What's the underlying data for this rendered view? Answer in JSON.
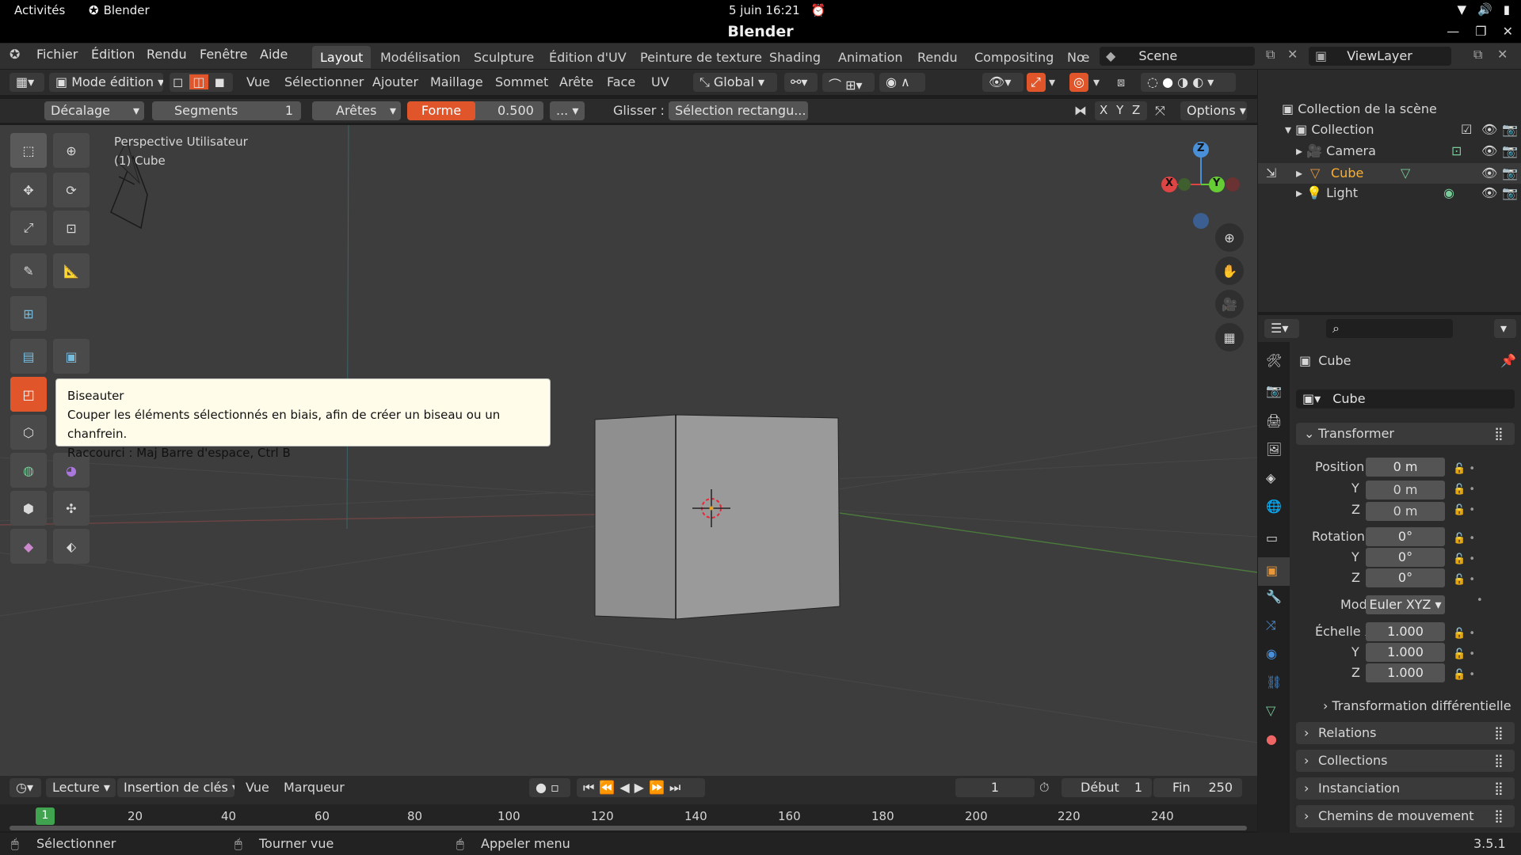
{
  "gnome": {
    "activities": "Activités",
    "app": "Blender",
    "clock": "5 juin  16:21"
  },
  "window": {
    "title": "Blender"
  },
  "menu": {
    "items": [
      "Fichier",
      "Édition",
      "Rendu",
      "Fenêtre",
      "Aide"
    ]
  },
  "workspaces": [
    "Layout",
    "Modélisation",
    "Sculpture",
    "Édition d'UV",
    "Peinture de texture",
    "Shading",
    "Animation",
    "Rendu",
    "Compositing",
    "Nœ"
  ],
  "scene": {
    "scene_name": "Scene",
    "view_layer": "ViewLayer"
  },
  "header": {
    "mode": "Mode édition",
    "menus": [
      "Vue",
      "Sélectionner",
      "Ajouter",
      "Maillage",
      "Sommet",
      "Arête",
      "Face",
      "UV"
    ],
    "orientation": "Global"
  },
  "tool_settings": {
    "offset": "Décalage",
    "segments_label": "Segments",
    "segments_value": "1",
    "affect": "Arêtes",
    "shape_label": "Forme",
    "shape_value": "0.500",
    "more": "...",
    "drag_label": "Glisser :",
    "drag_value": "Sélection rectangu...",
    "axes": [
      "X",
      "Y",
      "Z"
    ],
    "options": "Options"
  },
  "viewport": {
    "perspective": "Perspective Utilisateur",
    "object": "(1) Cube"
  },
  "gizmo": {
    "z": "Z",
    "y": "Y",
    "x": "X"
  },
  "tooltip": {
    "title": "Biseauter",
    "description": "Couper les éléments sélectionnés en biais, afin de créer un biseau ou un chanfrein.",
    "shortcut": "Raccourci : Maj Barre d'espace, Ctrl B"
  },
  "outliner": {
    "root": "Collection de la scène",
    "collection": "Collection",
    "items": [
      "Camera",
      "Cube",
      "Light"
    ]
  },
  "properties": {
    "object_name": "Cube",
    "data_name": "Cube",
    "transform": "Transformer",
    "position_label": "Position X",
    "position": [
      "0 m",
      "0 m",
      "0 m"
    ],
    "rotation_label": "Rotation X",
    "rotation": [
      "0°",
      "0°",
      "0°"
    ],
    "mode_label": "Mode",
    "mode_value": "Euler XYZ",
    "scale_label": "Échelle X",
    "scale": [
      "1.000",
      "1.000",
      "1.000"
    ],
    "y": "Y",
    "z": "Z",
    "delta": "Transformation différentielle",
    "sections": [
      "Relations",
      "Collections",
      "Instanciation",
      "Chemins de mouvement"
    ]
  },
  "timeline": {
    "playback": "Lecture",
    "keying": "Insertion de clés",
    "view": "Vue",
    "marker": "Marqueur",
    "current_frame": "1",
    "start_label": "Début",
    "start": "1",
    "end_label": "Fin",
    "end": "250",
    "ruler_current": "1",
    "ticks": [
      "20",
      "40",
      "60",
      "80",
      "100",
      "120",
      "140",
      "160",
      "180",
      "200",
      "220",
      "240"
    ]
  },
  "status": {
    "select": "Sélectionner",
    "rotate": "Tourner vue",
    "menu": "Appeler menu",
    "version": "3.5.1"
  },
  "colors": {
    "accent": "#e0562a",
    "selected_text": "#ffaf29"
  }
}
